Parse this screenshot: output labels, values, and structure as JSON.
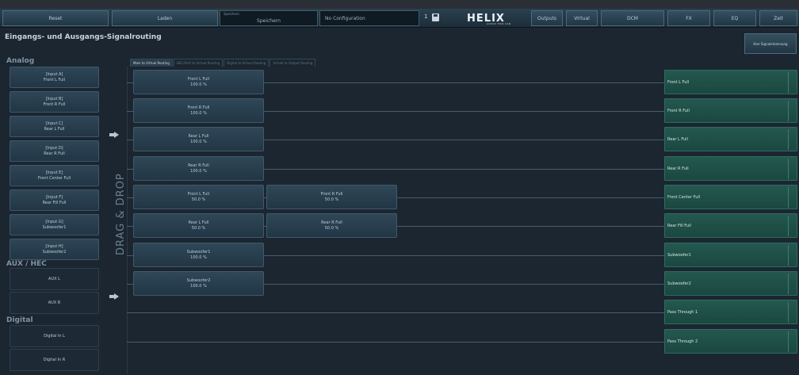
{
  "toolbar": {
    "reset": "Reset",
    "load": "Laden",
    "preset_caption": "Speichern",
    "preset_value": "Speichern",
    "config": "No Configuration",
    "config_num": "1",
    "logo": "HELIX",
    "logo_sub": "AUDIO FOR CAR",
    "outputs": "Outputs",
    "virtual": "Virtual",
    "dcm": "DCM",
    "fx": "FX",
    "eq": "EQ",
    "zeit": "Zeit"
  },
  "page": {
    "title": "Eingangs- und Ausgangs-Signalrouting",
    "help": "Hier Signalerkennung"
  },
  "left": {
    "analog_h": "Analog",
    "aux_h": "AUX / HEC",
    "digital_h": "Digital",
    "analog": [
      {
        "l1": "[Input A]",
        "l2": "Front L Full"
      },
      {
        "l1": "[Input B]",
        "l2": "Front R Full"
      },
      {
        "l1": "[Input C]",
        "l2": "Rear L Full"
      },
      {
        "l1": "[Input D]",
        "l2": "Rear R Full"
      },
      {
        "l1": "[Input E]",
        "l2": "Front Center Full"
      },
      {
        "l1": "[Input F]",
        "l2": "Rear Fill Full"
      },
      {
        "l1": "[Input G]",
        "l2": "Subwoofer1"
      },
      {
        "l1": "[Input H]",
        "l2": "Subwoofer2"
      }
    ],
    "aux": [
      "AUX L",
      "AUX R"
    ],
    "digital": [
      "Digital In L",
      "Digital In R"
    ],
    "dragdrop": "DRAG & DROP"
  },
  "tabs": [
    "Main to Virtual Routing",
    "HEC/AUX to Virtual Routing",
    "Digital to Virtual Routing",
    "Virtual to Output Routing"
  ],
  "sources": [
    {
      "name": "Front L Full",
      "pct": "100.0 %"
    },
    {
      "name": "Front R Full",
      "pct": "100.0 %"
    },
    {
      "name": "Rear L Full",
      "pct": "100.0 %"
    },
    {
      "name": "Rear R Full",
      "pct": "100.0 %"
    },
    {
      "name": "Front L Full",
      "pct": "50.0 %"
    },
    {
      "name": "Front R Full",
      "pct": "50.0 %"
    },
    {
      "name": "Rear L Full",
      "pct": "50.0 %"
    },
    {
      "name": "Rear R Full",
      "pct": "50.0 %"
    },
    {
      "name": "Subwoofer1",
      "pct": "100.0 %"
    },
    {
      "name": "Subwoofer2",
      "pct": "100.0 %"
    }
  ],
  "outputs": [
    "Front L Full",
    "Front R Full",
    "Rear L Full",
    "Rear R Full",
    "Front Center Full",
    "Rear Fill Full",
    "Subwoofer1",
    "Subwoofer2",
    "Pass Through 1",
    "Pass Through 2"
  ]
}
